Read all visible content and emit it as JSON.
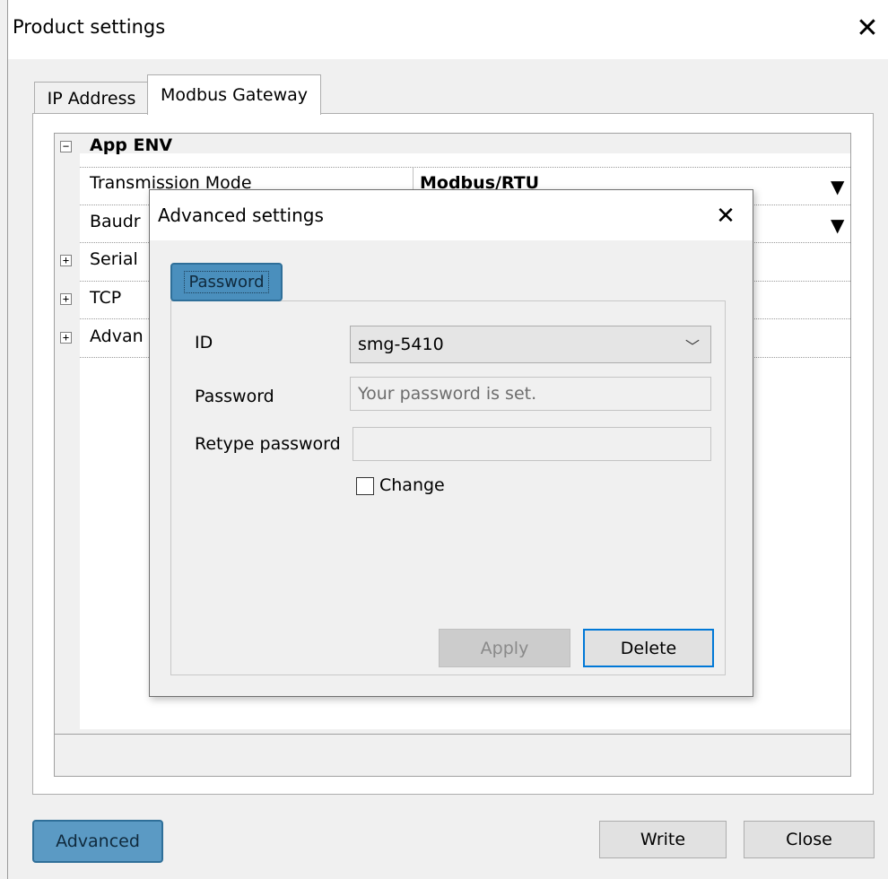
{
  "window": {
    "title": "Product settings",
    "close_glyph": "✕"
  },
  "tabs": [
    {
      "label": "IP Address",
      "active": false
    },
    {
      "label": "Modbus Gateway",
      "active": true
    }
  ],
  "grid": {
    "category_app_env": {
      "label": "App ENV",
      "expander": "−"
    },
    "rows": [
      {
        "name": "Transmission Mode",
        "value": "Modbus/RTU"
      },
      {
        "name": "Baudr",
        "value": ""
      }
    ],
    "categories_collapsed": [
      {
        "label": "Serial",
        "expander": "+"
      },
      {
        "label": "TCP",
        "expander": "+"
      },
      {
        "label": "Advan",
        "expander": "+"
      }
    ],
    "dropdown_glyph": "▼"
  },
  "footer": {
    "advanced_label": "Advanced",
    "write_label": "Write",
    "close_label": "Close"
  },
  "dialog": {
    "title": "Advanced settings",
    "close_glyph": "✕",
    "tab_label": "Password",
    "id_label": "ID",
    "id_value": "smg-5410",
    "password_label": "Password",
    "password_placeholder": "Your password is set.",
    "retype_label": "Retype password",
    "retype_value": "",
    "change_label": "Change",
    "change_checked": false,
    "apply_label": "Apply",
    "delete_label": "Delete"
  },
  "colors": {
    "accent_blue": "#0078d7",
    "highlight_button": "#5b9ac4"
  }
}
